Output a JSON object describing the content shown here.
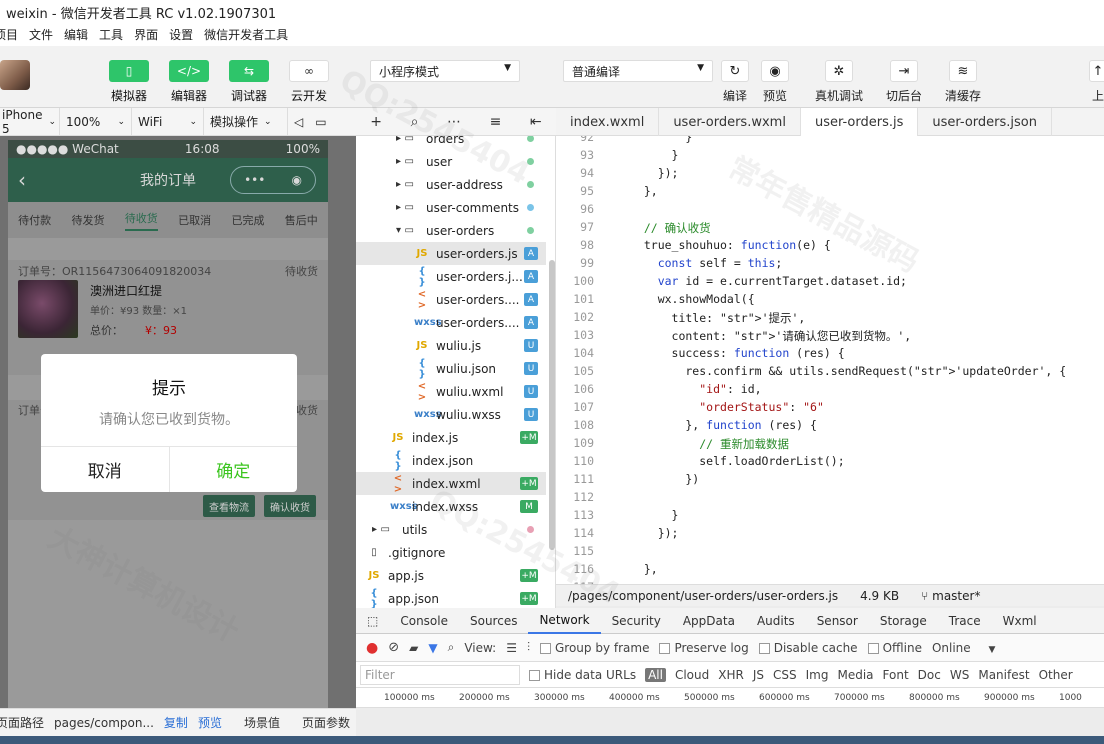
{
  "window": {
    "title": "weixin - 微信开发者工具 RC v1.02.1907301"
  },
  "menu": [
    "项目",
    "文件",
    "编辑",
    "工具",
    "界面",
    "设置",
    "微信开发者工具"
  ],
  "toolbar": {
    "simulator": "模拟器",
    "editor": "编辑器",
    "debugger": "调试器",
    "cloud": "云开发",
    "mode_select": "小程序模式",
    "compile_select": "普通编译",
    "compile": "编译",
    "preview": "预览",
    "real_debug": "真机调试",
    "background": "切后台",
    "clear_cache": "清缓存",
    "upload": "上"
  },
  "device_bar": {
    "device": "iPhone 5",
    "zoom": "100%",
    "network": "WiFi",
    "operate": "模拟操作"
  },
  "phone": {
    "carrier": "●●●●● WeChat",
    "time": "16:08",
    "battery": "100%",
    "nav_title": "我的订单",
    "tabs": [
      "待付款",
      "待发货",
      "待收货",
      "已取消",
      "已完成",
      "售后中"
    ],
    "order1": {
      "number": "订单号：OR1156473064091820034",
      "status": "待收货",
      "product": "澳洲进口红提",
      "info": "单价：¥93      数量：×1",
      "total_label": "总价：",
      "total_value": "¥：93"
    },
    "order2": {
      "number": "订单号",
      "status": "待收货"
    },
    "btn_logistics": "查看物流",
    "btn_confirm": "确认收货",
    "modal": {
      "title": "提示",
      "content": "请确认您已收到货物。",
      "cancel": "取消",
      "ok": "确定"
    }
  },
  "file_tree": [
    {
      "name": "orders",
      "type": "folder",
      "indent": 1
    },
    {
      "name": "user",
      "type": "folder",
      "indent": 1
    },
    {
      "name": "user-address",
      "type": "folder",
      "indent": 1
    },
    {
      "name": "user-comments",
      "type": "folder",
      "indent": 1
    },
    {
      "name": "user-orders",
      "type": "folder-open",
      "indent": 1
    },
    {
      "name": "user-orders.js",
      "type": "js",
      "indent": 2,
      "badge": "A",
      "selected": true
    },
    {
      "name": "user-orders.j...",
      "type": "json",
      "indent": 2,
      "badge": "A"
    },
    {
      "name": "user-orders....",
      "type": "wxml",
      "indent": 2,
      "badge": "A"
    },
    {
      "name": "user-orders....",
      "type": "wxss",
      "indent": 2,
      "badge": "A"
    },
    {
      "name": "wuliu.js",
      "type": "js",
      "indent": 2,
      "badge": "U"
    },
    {
      "name": "wuliu.json",
      "type": "json",
      "indent": 2,
      "badge": "U"
    },
    {
      "name": "wuliu.wxml",
      "type": "wxml",
      "indent": 2,
      "badge": "U"
    },
    {
      "name": "wuliu.wxss",
      "type": "wxss",
      "indent": 2,
      "badge": "U"
    },
    {
      "name": "index.js",
      "type": "js",
      "indent": 1,
      "badge": "+M"
    },
    {
      "name": "index.json",
      "type": "json",
      "indent": 1
    },
    {
      "name": "index.wxml",
      "type": "wxml",
      "indent": 1,
      "badge": "+M",
      "selected": true
    },
    {
      "name": "index.wxss",
      "type": "wxss",
      "indent": 1,
      "badge": "M"
    },
    {
      "name": "utils",
      "type": "folder",
      "indent": 0
    },
    {
      "name": ".gitignore",
      "type": "file",
      "indent": 0
    },
    {
      "name": "app.js",
      "type": "js",
      "indent": 0,
      "badge": "+M"
    },
    {
      "name": "app.json",
      "type": "json",
      "indent": 0,
      "badge": "+M"
    }
  ],
  "editor_tabs": [
    "index.wxml",
    "user-orders.wxml",
    "user-orders.js",
    "user-orders.json"
  ],
  "active_tab": "user-orders.js",
  "code_lines": [
    {
      "n": "92",
      "t": "        }"
    },
    {
      "n": "93",
      "t": "      }"
    },
    {
      "n": "94",
      "t": "    });"
    },
    {
      "n": "95",
      "t": "  },"
    },
    {
      "n": "96",
      "t": ""
    },
    {
      "n": "97",
      "t": "  // 确认收货"
    },
    {
      "n": "98",
      "t": "  true_shouhuo: function(e) {"
    },
    {
      "n": "99",
      "t": "    const self = this;"
    },
    {
      "n": "100",
      "t": "    var id = e.currentTarget.dataset.id;"
    },
    {
      "n": "101",
      "t": "    wx.showModal({"
    },
    {
      "n": "102",
      "t": "      title: '提示',"
    },
    {
      "n": "103",
      "t": "      content: '请确认您已收到货物。',"
    },
    {
      "n": "104",
      "t": "      success: function (res) {"
    },
    {
      "n": "105",
      "t": "        res.confirm && utils.sendRequest('updateOrder', {"
    },
    {
      "n": "106",
      "t": "          \"id\": id,"
    },
    {
      "n": "107",
      "t": "          \"orderStatus\": \"6\""
    },
    {
      "n": "108",
      "t": "        }, function (res) {"
    },
    {
      "n": "109",
      "t": "          // 重新加载数据"
    },
    {
      "n": "110",
      "t": "          self.loadOrderList();"
    },
    {
      "n": "111",
      "t": "        })"
    },
    {
      "n": "112",
      "t": ""
    },
    {
      "n": "113",
      "t": "      }"
    },
    {
      "n": "114",
      "t": "    });"
    },
    {
      "n": "115",
      "t": ""
    },
    {
      "n": "116",
      "t": "  },"
    },
    {
      "n": "117",
      "t": ""
    }
  ],
  "editor_status": {
    "path": "/pages/component/user-orders/user-orders.js",
    "size": "4.9 KB",
    "branch": "master*"
  },
  "devtools": {
    "tabs": [
      "Console",
      "Sources",
      "Network",
      "Security",
      "AppData",
      "Audits",
      "Sensor",
      "Storage",
      "Trace",
      "Wxml"
    ],
    "active": "Network",
    "view_label": "View:",
    "group_by_frame": "Group by frame",
    "preserve_log": "Preserve log",
    "disable_cache": "Disable cache",
    "offline": "Offline",
    "online": "Online",
    "filter_placeholder": "Filter",
    "hide_data_urls": "Hide data URLs",
    "filters": [
      "All",
      "Cloud",
      "XHR",
      "JS",
      "CSS",
      "Img",
      "Media",
      "Font",
      "Doc",
      "WS",
      "Manifest",
      "Other"
    ],
    "timeline": [
      "100000 ms",
      "200000 ms",
      "300000 ms",
      "400000 ms",
      "500000 ms",
      "600000 ms",
      "700000 ms",
      "800000 ms",
      "900000 ms",
      "1000"
    ]
  },
  "bottom": {
    "path_label": "页面路径",
    "path": "pages/compon...",
    "copy": "复制",
    "preview": "预览",
    "scene": "场景值",
    "params": "页面参数"
  },
  "watermark": [
    "QQ:2545404",
    "常年售精品源码",
    "大神计算机设计"
  ]
}
